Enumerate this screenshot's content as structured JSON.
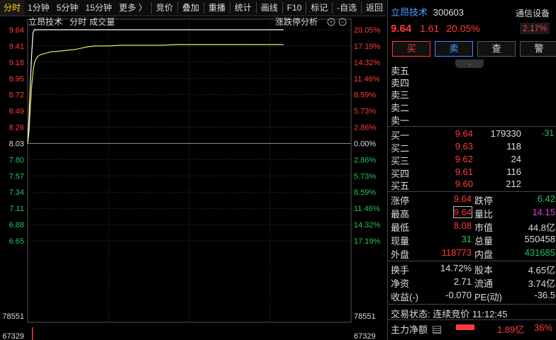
{
  "toolbar": {
    "tabs": [
      "分时",
      "1分钟",
      "5分钟",
      "15分钟",
      "更多 〉"
    ],
    "actions": [
      "竞价",
      "叠加",
      "重播",
      "统计",
      "画线",
      "F10",
      "标记",
      "-自选",
      "返回"
    ]
  },
  "chart": {
    "title_name": "立昂技术",
    "title_mode": "分时",
    "title_sub": "成交量",
    "analysis_label": "涨跌停分析",
    "price_labels": [
      "9.64",
      "9.41",
      "9.18",
      "8.95",
      "8.72",
      "8.49",
      "8.26",
      "8.03",
      "7.80",
      "7.57",
      "7.34",
      "7.11",
      "6.88",
      "6.65"
    ],
    "pct_labels": [
      "20.05%",
      "17.19%",
      "14.32%",
      "11.46%",
      "8.59%",
      "5.73%",
      "2.86%",
      "0.00%",
      "2.86%",
      "5.73%",
      "8.59%",
      "11.46%",
      "14.32%",
      "17.19%"
    ],
    "vol_labels": [
      "78551",
      "67329"
    ],
    "colors": {
      "up": "#ff3b3b",
      "down": "#22c55e",
      "flat": "#dddddd",
      "price_line": "#ffffff",
      "avg_line": "#e8e84a"
    }
  },
  "chart_data": {
    "type": "line",
    "title": "立昂技术",
    "x": [
      0,
      1,
      2,
      3,
      4,
      5,
      6,
      7,
      8,
      9,
      10,
      12,
      14,
      16,
      18,
      20,
      25,
      30,
      35,
      40,
      45,
      50,
      55,
      60,
      70,
      80,
      90,
      100,
      110,
      120,
      130,
      140,
      150,
      160,
      170,
      180,
      190
    ],
    "series": [
      {
        "values": [
          8.03,
          8.4,
          8.9,
          9.3,
          9.6,
          9.64,
          9.64,
          9.64,
          9.64,
          9.64,
          9.64,
          9.64,
          9.64,
          9.64,
          9.64,
          9.64,
          9.64,
          9.64,
          9.64,
          9.64,
          9.64,
          9.64,
          9.64,
          9.64,
          9.64,
          9.64,
          9.64,
          9.64,
          9.64,
          9.64,
          9.64,
          9.64,
          9.64,
          9.64,
          9.64,
          9.64,
          9.64
        ]
      },
      {
        "values": [
          8.03,
          8.2,
          8.55,
          8.85,
          9.05,
          9.17,
          9.22,
          9.25,
          9.27,
          9.28,
          9.29,
          9.3,
          9.31,
          9.32,
          9.33,
          9.33,
          9.34,
          9.35,
          9.36,
          9.38,
          9.4,
          9.41,
          9.41,
          9.41,
          9.42,
          9.42,
          9.42,
          9.42,
          9.43,
          9.43,
          9.43,
          9.43,
          9.43,
          9.43,
          9.43,
          9.43,
          9.43
        ]
      }
    ],
    "ylim": [
      6.42,
      9.64
    ]
  },
  "quote": {
    "name": "立昂技术",
    "code": "300603",
    "industry": "通信设备",
    "price": "9.64",
    "change": "1.61",
    "change_pct": "20.05%",
    "amplitude": "2.17%",
    "buttons": {
      "buy": "买",
      "sell": "卖",
      "query": "查",
      "alert": "警"
    },
    "collapse_glyph": "⌄"
  },
  "orderbook": {
    "asks": [
      {
        "label": "卖五",
        "price": "",
        "vol": ""
      },
      {
        "label": "卖四",
        "price": "",
        "vol": ""
      },
      {
        "label": "卖三",
        "price": "",
        "vol": ""
      },
      {
        "label": "卖二",
        "price": "",
        "vol": ""
      },
      {
        "label": "卖一",
        "price": "",
        "vol": ""
      }
    ],
    "bids": [
      {
        "label": "买一",
        "price": "9.64",
        "vol": "179330",
        "chg": "-31"
      },
      {
        "label": "买二",
        "price": "9.63",
        "vol": "118",
        "chg": ""
      },
      {
        "label": "买三",
        "price": "9.62",
        "vol": "24",
        "chg": ""
      },
      {
        "label": "买四",
        "price": "9.61",
        "vol": "116",
        "chg": ""
      },
      {
        "label": "买五",
        "price": "9.60",
        "vol": "212",
        "chg": ""
      }
    ]
  },
  "stats": {
    "limit_up_label": "涨停",
    "limit_up": "9.64",
    "limit_down_label": "跌停",
    "limit_down": "6.42",
    "high_label": "最高",
    "high": "9.64",
    "vol_ratio_label": "量比",
    "vol_ratio": "14.15",
    "low_label": "最低",
    "low": "8.08",
    "mktcap_label": "市值",
    "mktcap": "44.8亿",
    "cur_vol_label": "现量",
    "cur_vol": "31",
    "total_vol_label": "总量",
    "total_vol": "550458",
    "outer_label": "外盘",
    "outer": "118773",
    "inner_label": "内盘",
    "inner": "431685",
    "turnover_label": "换手",
    "turnover": "14.72%",
    "equity_label": "股本",
    "equity": "4.65亿",
    "nav_label": "净资",
    "nav": "2.71",
    "float_label": "流通",
    "float": "3.74亿",
    "eps_label": "收益(-)",
    "eps": "-0.070",
    "pe_label": "PE(动)",
    "pe": "-36.5"
  },
  "status": {
    "label": "交易状态:",
    "value": "连续竞价 11:12:45"
  },
  "netflow": {
    "label": "主力净额",
    "amount": "1.89亿",
    "pct": "36%"
  }
}
